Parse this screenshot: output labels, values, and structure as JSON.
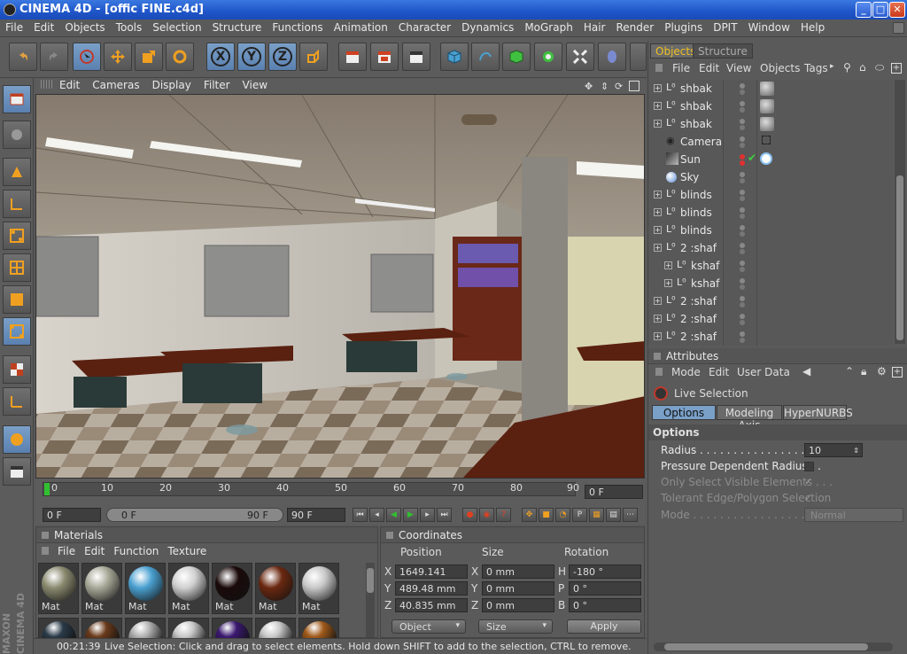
{
  "window": {
    "title": "CINEMA 4D - [offic FINE.c4d]",
    "min": "_",
    "max": "□",
    "close": "✕"
  },
  "menu": [
    "File",
    "Edit",
    "Objects",
    "Tools",
    "Selection",
    "Structure",
    "Functions",
    "Animation",
    "Character",
    "Dynamics",
    "MoGraph",
    "Hair",
    "Render",
    "Plugins",
    "DPIT",
    "Window",
    "Help"
  ],
  "toolbar": {
    "x_label": "X",
    "y_label": "Y",
    "z_label": "Z"
  },
  "viewport": {
    "menu": [
      "Edit",
      "Cameras",
      "Display",
      "Filter",
      "View"
    ]
  },
  "timeline": {
    "ticks": [
      "0",
      "10",
      "20",
      "30",
      "40",
      "50",
      "60",
      "70",
      "80",
      "90"
    ],
    "current_frame": "0 F"
  },
  "playback": {
    "start": "0 F",
    "range_start": "0 F",
    "range_end": "90 F",
    "end": "90 F"
  },
  "materials": {
    "title": "Materials",
    "menu": [
      "File",
      "Edit",
      "Function",
      "Texture"
    ],
    "label": "Mat",
    "colors": [
      "#8a8a70",
      "#a8a898",
      "#4aa0d0",
      "#d0d0d0",
      "#1a0a0a",
      "#6a2810",
      "#c8c8c8"
    ],
    "row2_colors": [
      "#2a3a48",
      "#6a3a1a",
      "#b0b0b0",
      "#c8c8c8",
      "#3a1870",
      "#c8c8c8",
      "#a05a1a"
    ]
  },
  "coordinates": {
    "title": "Coordinates",
    "headers": {
      "position": "Position",
      "size": "Size",
      "rotation": "Rotation"
    },
    "rows": [
      {
        "axis": "X",
        "pos": "1649.141 mm",
        "saxis": "X",
        "size": "0 mm",
        "raxis": "H",
        "rot": "-180 °"
      },
      {
        "axis": "Y",
        "pos": "489.48 mm",
        "saxis": "Y",
        "size": "0 mm",
        "raxis": "P",
        "rot": "0 °"
      },
      {
        "axis": "Z",
        "pos": "40.835 mm",
        "saxis": "Z",
        "size": "0 mm",
        "raxis": "B",
        "rot": "0 °"
      }
    ],
    "mode_object": "Object",
    "mode_size": "Size",
    "apply": "Apply"
  },
  "status": {
    "time": "00:21:39",
    "message": "Live Selection: Click and drag to select elements. Hold down SHIFT to add to the selection, CTRL to remove."
  },
  "objects": {
    "tabs": [
      "Objects",
      "Structure"
    ],
    "menu": [
      "File",
      "Edit",
      "View",
      "Objects",
      "Tags"
    ],
    "rows": [
      {
        "name": "shbak",
        "indent": 0,
        "prefix": "L0"
      },
      {
        "name": "shbak",
        "indent": 0,
        "prefix": "L0"
      },
      {
        "name": "shbak",
        "indent": 0,
        "prefix": "L0"
      },
      {
        "name": "Camera",
        "indent": 0,
        "prefix": "cam"
      },
      {
        "name": "Sun",
        "indent": 0,
        "prefix": "sun"
      },
      {
        "name": "Sky",
        "indent": 0,
        "prefix": "sky"
      },
      {
        "name": "blinds",
        "indent": 0,
        "prefix": "L0"
      },
      {
        "name": "blinds",
        "indent": 0,
        "prefix": "L0"
      },
      {
        "name": "blinds",
        "indent": 0,
        "prefix": "L0"
      },
      {
        "name": "2 :shaf",
        "indent": 0,
        "prefix": "L0"
      },
      {
        "name": "kshaf",
        "indent": 1,
        "prefix": "L0"
      },
      {
        "name": "kshaf",
        "indent": 1,
        "prefix": "L0"
      },
      {
        "name": "2 :shaf",
        "indent": 0,
        "prefix": "L0"
      },
      {
        "name": "2 :shaf",
        "indent": 0,
        "prefix": "L0"
      },
      {
        "name": "2 :shaf",
        "indent": 0,
        "prefix": "L0"
      }
    ]
  },
  "attributes": {
    "title": "Attributes",
    "menu": [
      "Mode",
      "Edit",
      "User Data"
    ],
    "tool": "Live Selection",
    "tabs": [
      "Options",
      "Modeling Axis",
      "HyperNURBS"
    ],
    "section": "Options",
    "radius_label": "Radius . . . . . . . . . . . . . . . . . . . .",
    "radius_value": "10",
    "pressure_label": "Pressure Dependent Radius . .",
    "visible_label": "Only Select Visible Elements . . .",
    "tolerant_label": "Tolerant Edge/Polygon Selection",
    "mode_label": "Mode . . . . . . . . . . . . . . . . . . . .",
    "mode_value": "Normal",
    "check": "✓"
  }
}
